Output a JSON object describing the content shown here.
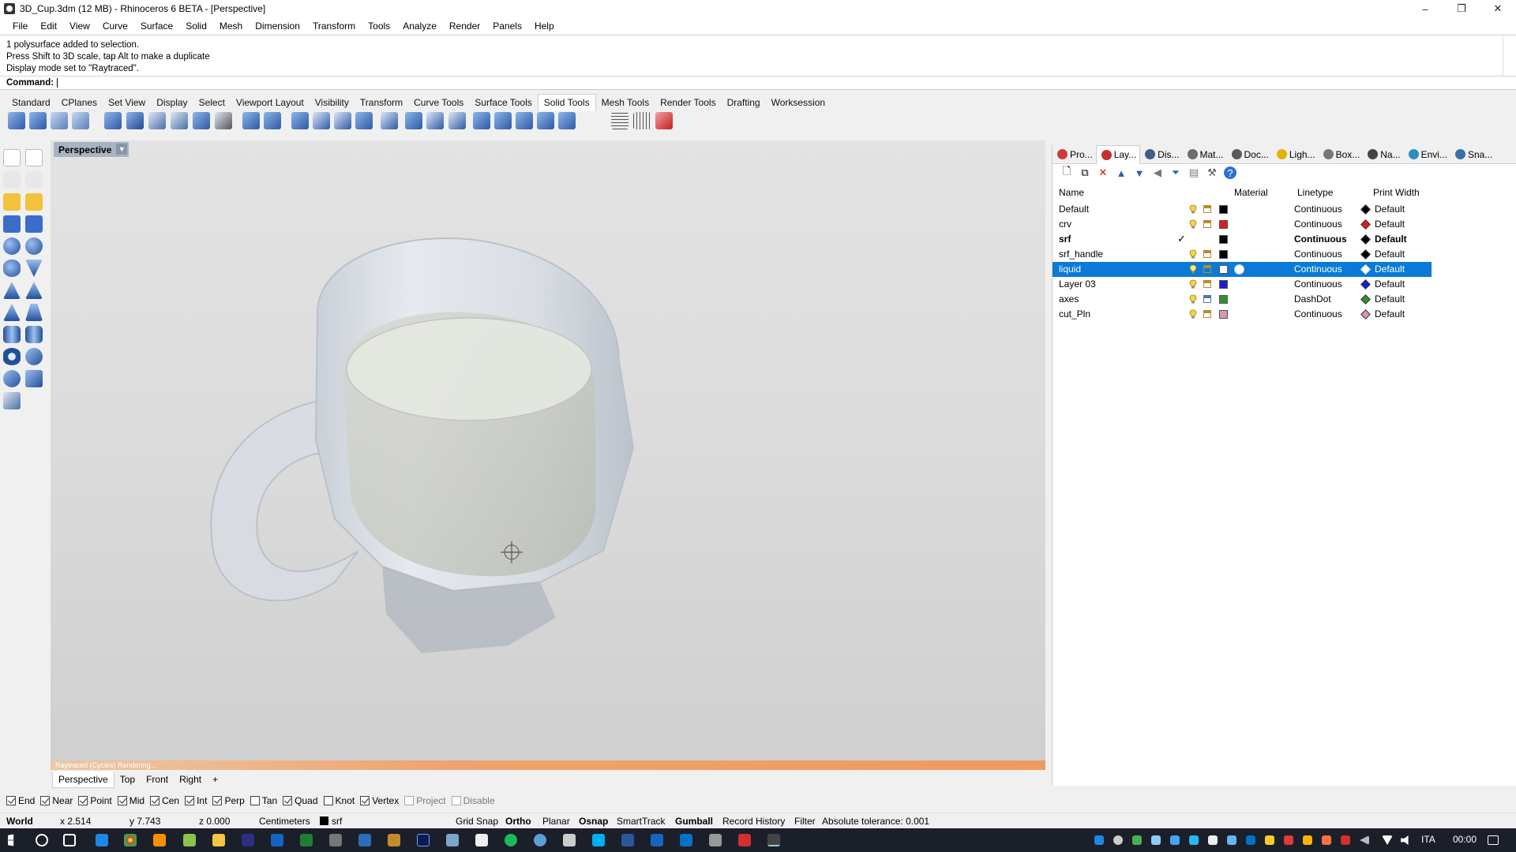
{
  "window": {
    "title": "3D_Cup.3dm (12 MB) - Rhinoceros 6 BETA - [Perspective]",
    "minimize": "–",
    "restore": "❐",
    "close": "✕"
  },
  "menu": [
    "File",
    "Edit",
    "View",
    "Curve",
    "Surface",
    "Solid",
    "Mesh",
    "Dimension",
    "Transform",
    "Tools",
    "Analyze",
    "Render",
    "Panels",
    "Help"
  ],
  "command_history": [
    "1 polysurface added to selection.",
    "Press Shift to 3D scale, tap Alt to make a duplicate",
    "Display mode set to \"Raytraced\"."
  ],
  "command_prompt": "Command:",
  "toolbar_tabs": [
    "Standard",
    "CPlanes",
    "Set View",
    "Display",
    "Select",
    "Viewport Layout",
    "Visibility",
    "Transform",
    "Curve Tools",
    "Surface Tools",
    "Solid Tools",
    "Mesh Tools",
    "Render Tools",
    "Drafting",
    "Worksession"
  ],
  "active_toolbar_tab": "Solid Tools",
  "viewport": {
    "title": "Perspective",
    "render_status": "Raytraced (Cycles)   Rendering...",
    "tabs": [
      "Perspective",
      "Top",
      "Front",
      "Right"
    ],
    "add_tab": "+"
  },
  "panel": {
    "tabs": [
      {
        "label": "Pro...",
        "color": "#d23a3a"
      },
      {
        "label": "Lay...",
        "color": "#c73030"
      },
      {
        "label": "Dis...",
        "color": "#3d5f8a"
      },
      {
        "label": "Mat...",
        "color": "#6c6c6c"
      },
      {
        "label": "Doc...",
        "color": "#5a5a5a"
      },
      {
        "label": "Ligh...",
        "color": "#e2b400"
      },
      {
        "label": "Box...",
        "color": "#777777"
      },
      {
        "label": "Na...",
        "color": "#444444"
      },
      {
        "label": "Envi...",
        "color": "#2a8fbf"
      },
      {
        "label": "Sna...",
        "color": "#3a6ea5"
      }
    ],
    "columns": {
      "name": "Name",
      "material": "Material",
      "linetype": "Linetype",
      "print_width": "Print Width"
    },
    "layers": [
      {
        "name": "Default",
        "color": "#000000",
        "linetype": "Continuous",
        "print_color": "#000000",
        "print_width": "Default",
        "current": false,
        "selected": false,
        "locked": false
      },
      {
        "name": "crv",
        "color": "#e01b1b",
        "linetype": "Continuous",
        "print_color": "#e01b1b",
        "print_width": "Default",
        "current": false,
        "selected": false,
        "locked": false
      },
      {
        "name": "srf",
        "color": "#000000",
        "linetype": "Continuous",
        "print_color": "#000000",
        "print_width": "Default",
        "current": true,
        "selected": false,
        "locked": false
      },
      {
        "name": "srf_handle",
        "color": "#000000",
        "linetype": "Continuous",
        "print_color": "#000000",
        "print_width": "Default",
        "current": false,
        "selected": false,
        "locked": false
      },
      {
        "name": "liquid",
        "color": "#ffffff",
        "linetype": "Continuous",
        "print_color": "#ffffff",
        "print_width": "Default",
        "current": false,
        "selected": true,
        "locked": false
      },
      {
        "name": "Layer 03",
        "color": "#1a1ad8",
        "linetype": "Continuous",
        "print_color": "#1a1ad8",
        "print_width": "Default",
        "current": false,
        "selected": false,
        "locked": false
      },
      {
        "name": "axes",
        "color": "#2f8f2f",
        "linetype": "DashDot",
        "print_color": "#2f8f2f",
        "print_width": "Default",
        "current": false,
        "selected": false,
        "locked": true
      },
      {
        "name": "cut_Pln",
        "color": "#d89aa8",
        "linetype": "Continuous",
        "print_color": "#d89aa8",
        "print_width": "Default",
        "current": false,
        "selected": false,
        "locked": false
      }
    ]
  },
  "osnaps": [
    {
      "label": "End",
      "on": true
    },
    {
      "label": "Near",
      "on": true
    },
    {
      "label": "Point",
      "on": true
    },
    {
      "label": "Mid",
      "on": true
    },
    {
      "label": "Cen",
      "on": true
    },
    {
      "label": "Int",
      "on": true
    },
    {
      "label": "Perp",
      "on": true
    },
    {
      "label": "Tan",
      "on": false
    },
    {
      "label": "Quad",
      "on": true
    },
    {
      "label": "Knot",
      "on": false
    },
    {
      "label": "Vertex",
      "on": true
    },
    {
      "label": "Project",
      "on": false,
      "dim": true
    },
    {
      "label": "Disable",
      "on": false,
      "dim": true
    }
  ],
  "status": {
    "cplane": "World",
    "x": "x 2.514",
    "y": "y 7.743",
    "z": "z 0.000",
    "units": "Centimeters",
    "layer": "srf",
    "grid_snap": "Grid Snap",
    "ortho": "Ortho",
    "planar": "Planar",
    "osnap": "Osnap",
    "smarttrack": "SmartTrack",
    "gumball": "Gumball",
    "record_history": "Record History",
    "filter": "Filter",
    "tolerance": "Absolute tolerance: 0.001"
  },
  "taskbar": {
    "language": "ITA",
    "time": "00:00"
  },
  "colors": {
    "selection": "#0a7ad6",
    "render_bar": "#ee9b5f",
    "viewport_title": "#a8b3c4"
  }
}
